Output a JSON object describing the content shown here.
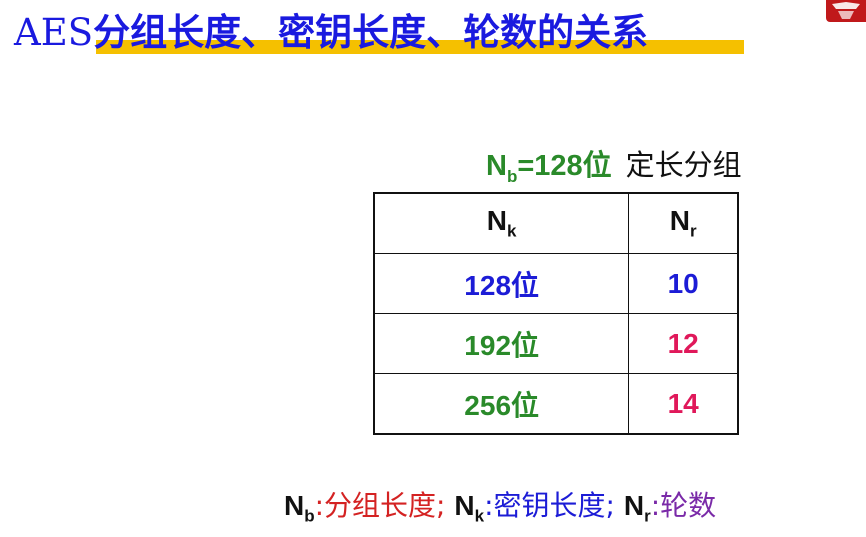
{
  "title": {
    "prefix": "AES",
    "main": "分组长度、密钥长度、轮数的关系"
  },
  "block_size": {
    "symbol": "N",
    "subscript": "b",
    "value": "=128位",
    "description": "定长分组"
  },
  "table": {
    "headers": [
      {
        "symbol": "N",
        "subscript": "k"
      },
      {
        "symbol": "N",
        "subscript": "r"
      }
    ],
    "rows": [
      {
        "key_length": "128位",
        "rounds": "10"
      },
      {
        "key_length": "192位",
        "rounds": "12"
      },
      {
        "key_length": "256位",
        "rounds": "14"
      }
    ]
  },
  "legend": {
    "nb": {
      "symbol": "N",
      "subscript": "b",
      "definition": ":分组长度;"
    },
    "nk": {
      "symbol": "N",
      "subscript": "k",
      "definition": ":密钥长度;"
    },
    "nr": {
      "symbol": "N",
      "subscript": "r",
      "definition": ":轮数"
    }
  },
  "colors": {
    "title": "#1a1adf",
    "title_highlight": "#f5c000",
    "green": "#2a8a2a",
    "blue": "#1c1cd6",
    "red": "#e0185a",
    "purple": "#7a2aa8"
  },
  "icons": {
    "logo": "university-logo-icon"
  }
}
